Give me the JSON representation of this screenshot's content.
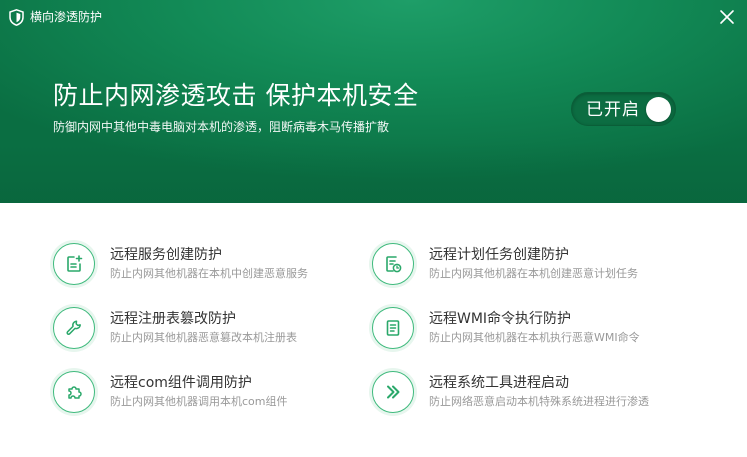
{
  "window": {
    "title": "横向渗透防护"
  },
  "hero": {
    "headline": "防止内网渗透攻击 保护本机安全",
    "subline": "防御内网中其他中毒电脑对本机的渗透，阻断病毒木马传播扩散",
    "toggle": {
      "label": "已开启",
      "state": "on"
    }
  },
  "colors": {
    "brand_green": "#128a56",
    "accent_green": "#3fba7d",
    "title_text": "#333333",
    "desc_text": "#999999"
  },
  "features": [
    {
      "title": "远程服务创建防护",
      "desc": "防止内网其他机器在本机中创建恶意服务",
      "icon": "service-add-icon"
    },
    {
      "title": "远程计划任务创建防护",
      "desc": "防止内网其他机器在本机创建恶意计划任务",
      "icon": "scheduled-task-icon"
    },
    {
      "title": "远程注册表篡改防护",
      "desc": "防止内网其他机器恶意篡改本机注册表",
      "icon": "wrench-icon"
    },
    {
      "title": "远程WMI命令执行防护",
      "desc": "防止内网其他机器在本机执行恶意WMI命令",
      "icon": "document-icon"
    },
    {
      "title": "远程com组件调用防护",
      "desc": "防止内网其他机器调用本机com组件",
      "icon": "puzzle-icon"
    },
    {
      "title": "远程系统工具进程启动",
      "desc": "防止网络恶意启动本机特殊系统进程进行渗透",
      "icon": "double-chevron-icon"
    }
  ]
}
